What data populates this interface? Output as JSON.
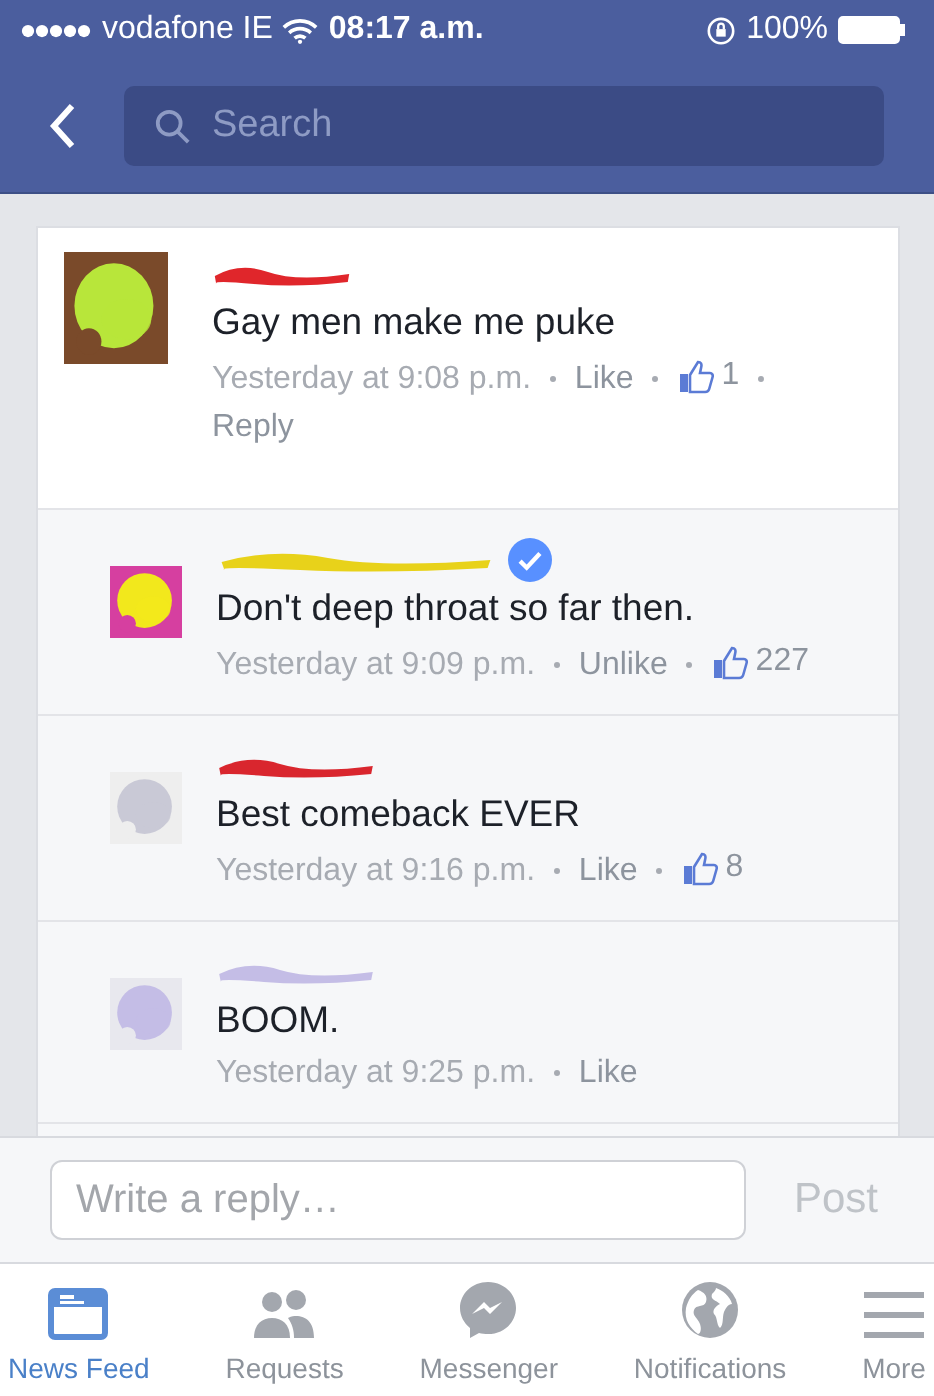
{
  "status_bar": {
    "carrier": "vodafone IE",
    "time": "08:17 a.m.",
    "battery": "100%"
  },
  "nav": {
    "search": {
      "placeholder": "Search"
    }
  },
  "comments": [
    {
      "verified": false,
      "body": "Gay men make me puke",
      "time": "Yesterday at 9:08 p.m.",
      "action": "Like",
      "likes": "1",
      "reply": "Reply",
      "children": [
        {
          "verified": true,
          "body": "Don't deep throat so far then.",
          "time": "Yesterday at 9:09 p.m.",
          "action": "Unlike",
          "likes": "227"
        },
        {
          "verified": false,
          "body": "Best comeback EVER",
          "time": "Yesterday at 9:16 p.m.",
          "action": "Like",
          "likes": "8"
        },
        {
          "verified": false,
          "body": "BOOM.",
          "time": "Yesterday at 9:25 p.m.",
          "action": "Like"
        }
      ]
    }
  ],
  "composer": {
    "placeholder": "Write a reply…",
    "post": "Post"
  },
  "tabs": [
    {
      "kind": "feed",
      "label": "News Feed",
      "selected": true
    },
    {
      "kind": "people",
      "label": "Requests",
      "selected": false
    },
    {
      "kind": "messenger",
      "label": "Messenger",
      "selected": false
    },
    {
      "kind": "globe",
      "label": "Notifications",
      "selected": false
    },
    {
      "kind": "menu",
      "label": "More",
      "selected": false
    }
  ]
}
